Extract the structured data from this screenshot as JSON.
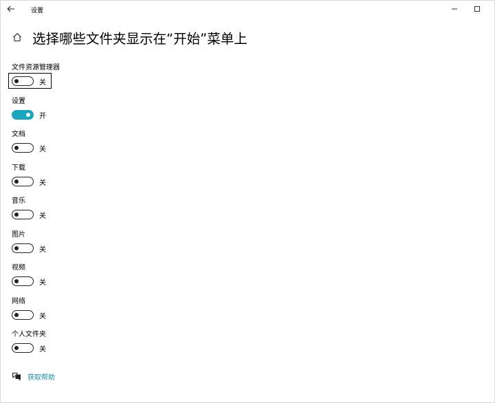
{
  "window": {
    "title": "设置"
  },
  "page": {
    "title": "选择哪些文件夹显示在“开始”菜单上"
  },
  "toggles": [
    {
      "label": "文件资源管理器",
      "state": "关",
      "on": false
    },
    {
      "label": "设置",
      "state": "开",
      "on": true
    },
    {
      "label": "文档",
      "state": "关",
      "on": false
    },
    {
      "label": "下载",
      "state": "关",
      "on": false
    },
    {
      "label": "音乐",
      "state": "关",
      "on": false
    },
    {
      "label": "图片",
      "state": "关",
      "on": false
    },
    {
      "label": "视频",
      "state": "关",
      "on": false
    },
    {
      "label": "网络",
      "state": "关",
      "on": false
    },
    {
      "label": "个人文件夹",
      "state": "关",
      "on": false
    }
  ],
  "help": {
    "label": "获取帮助"
  },
  "colors": {
    "accent": "#1aa7bd",
    "link": "#1a8fa3"
  },
  "icons": {
    "back": "back-arrow-icon",
    "home": "home-icon",
    "help": "help-chat-icon",
    "minimize": "minimize-icon",
    "maximize": "maximize-icon"
  }
}
